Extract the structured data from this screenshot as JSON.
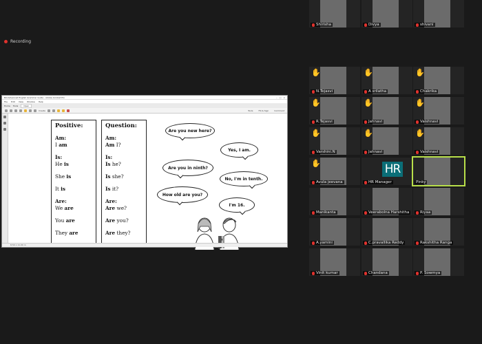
{
  "recording": {
    "label": "Recording"
  },
  "reader": {
    "title": "Bill Advanced English Grammar Guide - Adobe Acrobat Pro",
    "menu": [
      "File",
      "Edit",
      "View",
      "Window",
      "Help"
    ],
    "tabs": {
      "home": "Home",
      "tools": "Tools",
      "open_tab": "Open"
    },
    "right_tabs": [
      "Tools",
      "Fill & Sign",
      "Comment"
    ],
    "toolbar": {
      "zoom": "Create",
      "customize": "Customize"
    },
    "status": "8.50 x 11.00 in"
  },
  "positive": {
    "title": "Positive:",
    "lines": [
      {
        "pre": "",
        "bold": "Am:",
        "post": ""
      },
      {
        "pre": "I ",
        "bold": "am",
        "post": ""
      },
      {
        "gap": true
      },
      {
        "pre": "",
        "bold": "Is:",
        "post": ""
      },
      {
        "pre": "He ",
        "bold": "is",
        "post": ""
      },
      {
        "gap": true
      },
      {
        "pre": "She ",
        "bold": "is",
        "post": ""
      },
      {
        "gap": true
      },
      {
        "pre": "It ",
        "bold": "is",
        "post": ""
      },
      {
        "gap": true
      },
      {
        "pre": "",
        "bold": "Are:",
        "post": ""
      },
      {
        "pre": "We ",
        "bold": "are",
        "post": ""
      },
      {
        "gap": true
      },
      {
        "pre": "You ",
        "bold": "are",
        "post": ""
      },
      {
        "gap": true
      },
      {
        "pre": "They ",
        "bold": "are",
        "post": ""
      }
    ]
  },
  "question": {
    "title": "Question:",
    "lines": [
      {
        "pre": "",
        "bold": "Am:",
        "post": ""
      },
      {
        "pre": "",
        "bold": "Am",
        "post": " I?"
      },
      {
        "gap": true
      },
      {
        "pre": "",
        "bold": "Is:",
        "post": ""
      },
      {
        "pre": "",
        "bold": "Is",
        "post": " he?"
      },
      {
        "gap": true
      },
      {
        "pre": "",
        "bold": "Is",
        "post": " she?"
      },
      {
        "gap": true
      },
      {
        "pre": "",
        "bold": "Is",
        "post": " it?"
      },
      {
        "gap": true
      },
      {
        "pre": "",
        "bold": "Are:",
        "post": ""
      },
      {
        "pre": "",
        "bold": "Are",
        "post": " we?"
      },
      {
        "gap": true
      },
      {
        "pre": "",
        "bold": "Are",
        "post": " you?"
      },
      {
        "gap": true
      },
      {
        "pre": "",
        "bold": "Are",
        "post": " they?"
      }
    ]
  },
  "bubbles": {
    "b1": "Are you new here?",
    "b2": "Yes, I am.",
    "b3": "Are you in ninth?",
    "b4": "No, I'm in tenth.",
    "b5": "How old are you?",
    "b6": "I'm 16."
  },
  "participants": [
    {
      "name": "N.Tejasvi",
      "hand": true,
      "muted": true
    },
    {
      "name": "A srilatha",
      "hand": true,
      "muted": true
    },
    {
      "name": "Chakrika",
      "hand": true,
      "muted": true
    },
    {
      "name": "R.Tejasvi",
      "hand": true,
      "muted": true
    },
    {
      "name": "Jahnavi",
      "hand": true,
      "muted": true
    },
    {
      "name": "Vaishnavi",
      "hand": true,
      "muted": true
    },
    {
      "name": "Varshini.N",
      "hand": true,
      "muted": true
    },
    {
      "name": "Jahnavi",
      "hand": true,
      "muted": true
    },
    {
      "name": "Vaishnavi",
      "hand": true,
      "muted": true
    },
    {
      "name": "Avula jeevana",
      "hand": true,
      "muted": true
    },
    {
      "name": "HR Manager",
      "hand": false,
      "muted": true,
      "initials": "HR"
    },
    {
      "name": "Pinky",
      "hand": false,
      "muted": false,
      "active": true
    },
    {
      "name": "Manikanta",
      "hand": false,
      "muted": true
    },
    {
      "name": "Veerabolna Harshitha",
      "hand": false,
      "muted": true
    },
    {
      "name": "Riyaa",
      "hand": false,
      "muted": true
    },
    {
      "name": "A.yamini",
      "hand": false,
      "muted": true
    },
    {
      "name": "C.pravallika Reddy",
      "hand": false,
      "muted": true
    },
    {
      "name": "Rakshitha Ranga",
      "hand": false,
      "muted": true
    },
    {
      "name": "Vinit kumar",
      "hand": false,
      "muted": true
    },
    {
      "name": "Chandana",
      "hand": false,
      "muted": true
    },
    {
      "name": "P. Sowmya",
      "hand": false,
      "muted": true
    },
    {
      "name": "Shirisha",
      "hand": false,
      "muted": true
    },
    {
      "name": "Divya",
      "hand": false,
      "muted": true
    },
    {
      "name": "shivani",
      "hand": false,
      "muted": true
    }
  ]
}
